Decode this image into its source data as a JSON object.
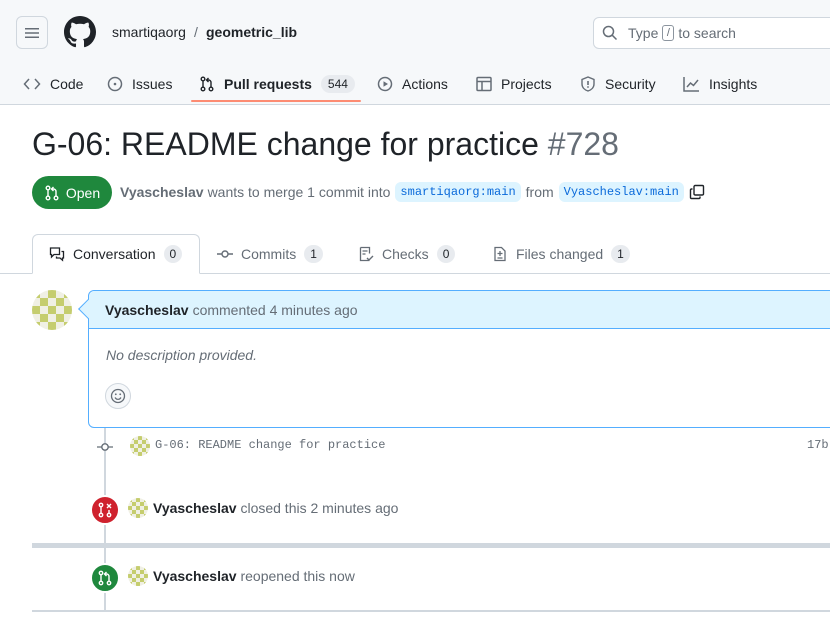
{
  "header": {
    "owner": "smartiqaorg",
    "separator": "/",
    "repo": "geometric_lib",
    "search_prefix": "Type",
    "search_key": "/",
    "search_suffix": "to search"
  },
  "nav": {
    "code": "Code",
    "issues": "Issues",
    "pull_requests": "Pull requests",
    "pull_requests_count": "544",
    "actions": "Actions",
    "projects": "Projects",
    "security": "Security",
    "insights": "Insights"
  },
  "pr": {
    "title": "G-06: README change for practice",
    "number": "#728",
    "state": "Open",
    "author": "Vyascheslav",
    "meta_text": "wants to merge 1 commit into",
    "base_branch": "smartiqaorg:main",
    "from_text": "from",
    "head_branch": "Vyascheslav:main"
  },
  "tabs": {
    "conversation": "Conversation",
    "conversation_count": "0",
    "commits": "Commits",
    "commits_count": "1",
    "checks": "Checks",
    "checks_count": "0",
    "files": "Files changed",
    "files_count": "1"
  },
  "comment": {
    "author": "Vyascheslav",
    "time_text": "commented 4 minutes ago",
    "body": "No description provided.",
    "kebab": "···"
  },
  "timeline": {
    "commit_message": "G-06: README change for practice",
    "commit_sha": "17b",
    "closed_author": "Vyascheslav",
    "closed_text": "closed this 2 minutes ago",
    "reopened_author": "Vyascheslav",
    "reopened_text": "reopened this now"
  },
  "colors": {
    "open_green": "#1f883d",
    "closed_red": "#cf222e",
    "accent_blue": "#0969da",
    "underline_orange": "#fd8c73"
  }
}
